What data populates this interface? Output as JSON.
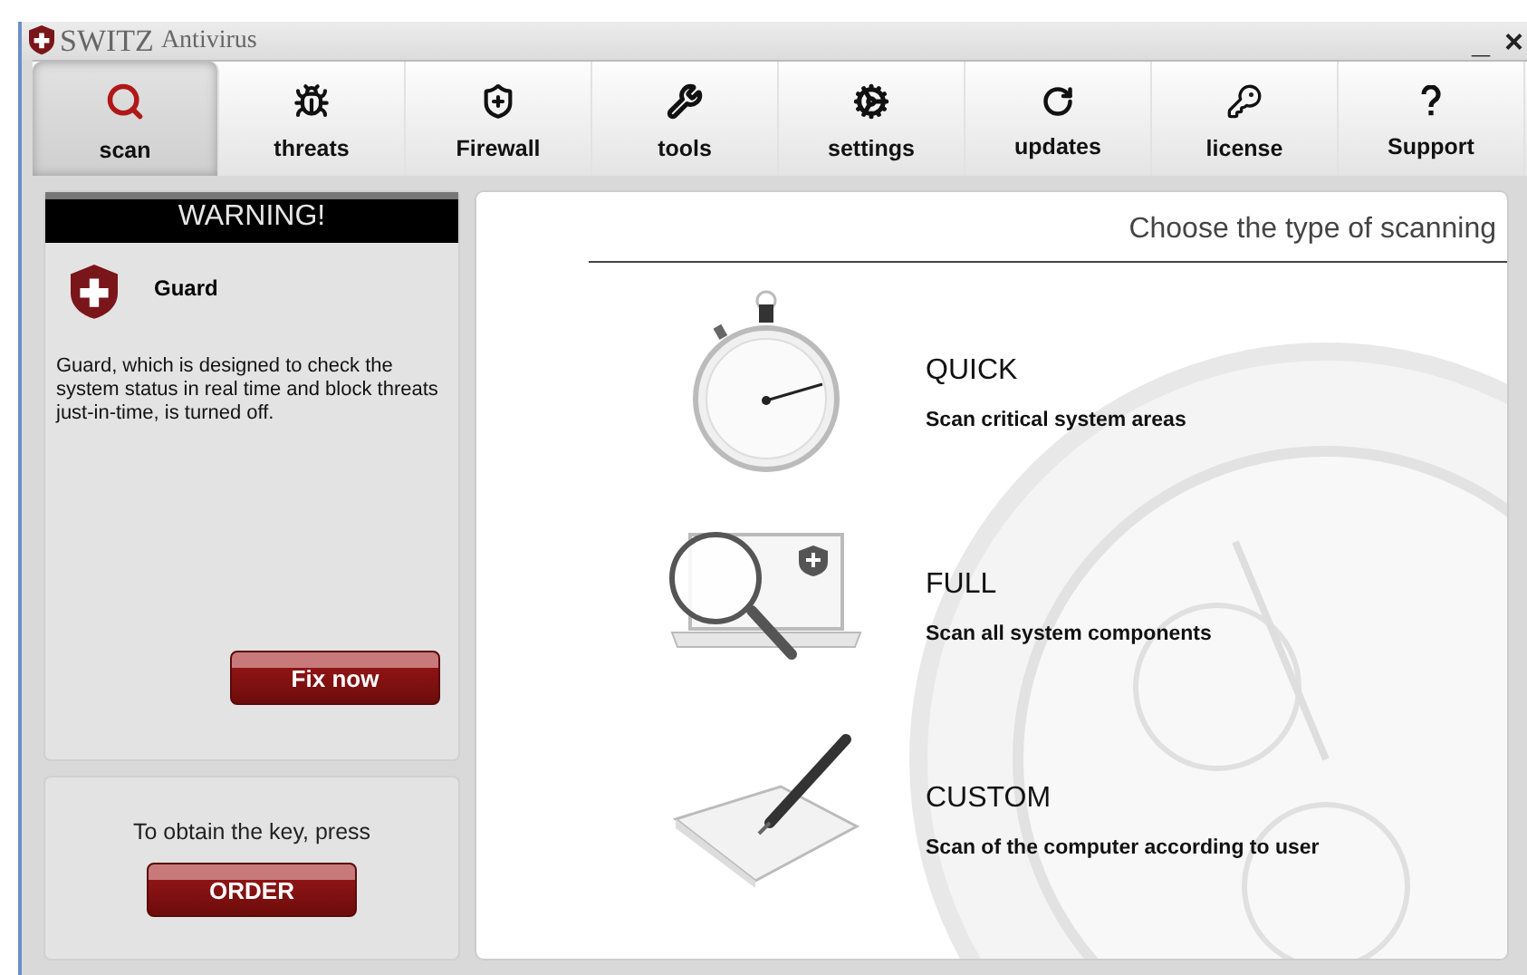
{
  "window": {
    "title_brand": "SWITZ",
    "title_product": "Antivirus",
    "controls": [
      "_",
      "×"
    ]
  },
  "tabs": [
    {
      "label": "scan",
      "selected": true
    },
    {
      "label": "threats",
      "selected": false
    },
    {
      "label": "Firewall",
      "selected": false
    },
    {
      "label": "tools",
      "selected": false
    },
    {
      "label": "settings",
      "selected": false
    },
    {
      "label": "updates",
      "selected": false
    },
    {
      "label": "license",
      "selected": false
    },
    {
      "label": "Support",
      "selected": false
    }
  ],
  "warning": {
    "heading": "WARNING!",
    "module": "Guard",
    "message": "Guard, which is designed to check the system status in real time and block threats just-in-time, is turned off.",
    "button": "Fix now"
  },
  "order": {
    "prompt": "To obtain the key, press",
    "button": "ORDER"
  },
  "scan_panel": {
    "title": "Choose the type of scanning",
    "options": [
      {
        "kind": "quick",
        "name": "QUICK",
        "description": "Scan critical system areas"
      },
      {
        "kind": "full",
        "name": "FULL",
        "description": "Scan all system components"
      },
      {
        "kind": "custom",
        "name": "CUSTOM",
        "description": "Scan of the computer according to user"
      }
    ]
  }
}
